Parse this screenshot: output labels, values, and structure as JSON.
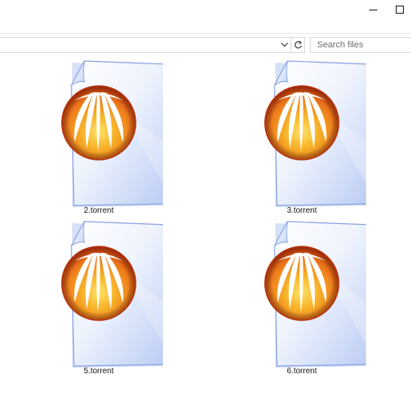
{
  "search": {
    "placeholder": "Search files"
  },
  "files": [
    {
      "name": "2.torrent",
      "icon": "bittorrent-file-icon"
    },
    {
      "name": "3.torrent",
      "icon": "bittorrent-file-icon"
    },
    {
      "name": "5.torrent",
      "icon": "bittorrent-file-icon"
    },
    {
      "name": "6.torrent",
      "icon": "bittorrent-file-icon"
    }
  ],
  "colors": {
    "page_light": "#ffffff",
    "page_blue": "#c9d8f7",
    "page_edge": "#7e9be0",
    "logo_red": "#d8401a",
    "logo_orange": "#f4a21a",
    "logo_yellow": "#fbd84a"
  }
}
